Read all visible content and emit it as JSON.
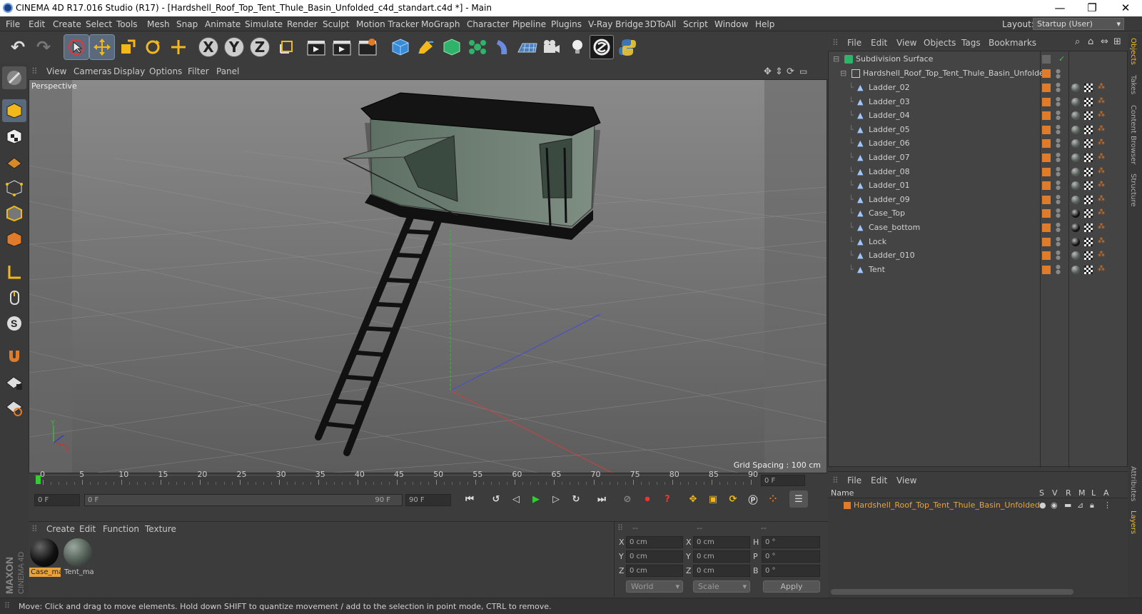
{
  "window": {
    "title": "CINEMA 4D R17.016 Studio (R17) - [Hardshell_Roof_Top_Tent_Thule_Basin_Unfolded_c4d_standart.c4d *] - Main",
    "minimize": "—",
    "restore": "❐",
    "close": "✕"
  },
  "menu": [
    "File",
    "Edit",
    "Create",
    "Select",
    "Tools",
    "Mesh",
    "Snap",
    "Animate",
    "Simulate",
    "Render",
    "Sculpt",
    "Motion Tracker",
    "MoGraph",
    "Character",
    "Pipeline",
    "Plugins",
    "V-Ray Bridge",
    "3DToAll",
    "Script",
    "Window",
    "Help"
  ],
  "layout": {
    "label": "Layout:",
    "value": "Startup (User)"
  },
  "toolbar": {
    "undo": "↶",
    "redo": "↷",
    "x_axis": "X",
    "y_axis": "Y",
    "z_axis": "Z"
  },
  "viewport": {
    "menu": [
      "View",
      "Cameras",
      "Display",
      "Options",
      "Filter",
      "Panel"
    ],
    "label": "Perspective",
    "grid_spacing": "Grid Spacing : 100 cm"
  },
  "timeline": {
    "ticks": [
      "0",
      "5",
      "10",
      "15",
      "20",
      "25",
      "30",
      "35",
      "40",
      "45",
      "50",
      "55",
      "60",
      "65",
      "70",
      "75",
      "80",
      "85",
      "90"
    ],
    "current_frame": "0 F",
    "start_frame": "0 F",
    "slider_start": "0 F",
    "slider_end": "90 F",
    "end_frame": "90 F"
  },
  "materials": {
    "menu": [
      "Create",
      "Edit",
      "Function",
      "Texture"
    ],
    "items": [
      {
        "name": "Case_ma",
        "color": "#111111",
        "selected": true
      },
      {
        "name": "Tent_ma",
        "color": "#4e5a52",
        "selected": false
      }
    ]
  },
  "coords": {
    "headers": [
      "--",
      "--",
      "--"
    ],
    "rows": [
      {
        "a": "X",
        "av": "0 cm",
        "b": "X",
        "bv": "0 cm",
        "c": "H",
        "cv": "0 °"
      },
      {
        "a": "Y",
        "av": "0 cm",
        "b": "Y",
        "bv": "0 cm",
        "c": "P",
        "cv": "0 °"
      },
      {
        "a": "Z",
        "av": "0 cm",
        "b": "Z",
        "bv": "0 cm",
        "c": "B",
        "cv": "0 °"
      }
    ],
    "mode1": "World",
    "mode2": "Scale",
    "apply": "Apply"
  },
  "objects": {
    "menu": [
      "File",
      "Edit",
      "View",
      "Objects",
      "Tags",
      "Bookmarks"
    ],
    "root": "Subdivision Surface",
    "group": "Hardshell_Roof_Top_Tent_Thule_Basin_Unfolded",
    "children": [
      "Ladder_02",
      "Ladder_03",
      "Ladder_04",
      "Ladder_05",
      "Ladder_06",
      "Ladder_07",
      "Ladder_08",
      "Ladder_01",
      "Ladder_09",
      "Case_Top",
      "Case_bottom",
      "Lock",
      "Ladder_010",
      "Tent"
    ]
  },
  "layers": {
    "menu": [
      "File",
      "Edit",
      "View"
    ],
    "columns": [
      "Name",
      "S",
      "V",
      "R",
      "M",
      "L",
      "A"
    ],
    "row": "Hardshell_Roof_Top_Tent_Thule_Basin_Unfolded"
  },
  "right_tabs": [
    "Objects",
    "Takes",
    "Content Browser",
    "Structure",
    "Attributes",
    "Layers"
  ],
  "status": "Move: Click and drag to move elements. Hold down SHIFT to quantize movement / add to the selection in point mode, CTRL to remove.",
  "brand": "MAXON CINEMA 4D",
  "colors": {
    "accent_orange": "#e07b2a",
    "selection_blue": "#5a6a7c",
    "viewport_bg": "#7a7a7a",
    "layer_text": "#e8a33c"
  }
}
